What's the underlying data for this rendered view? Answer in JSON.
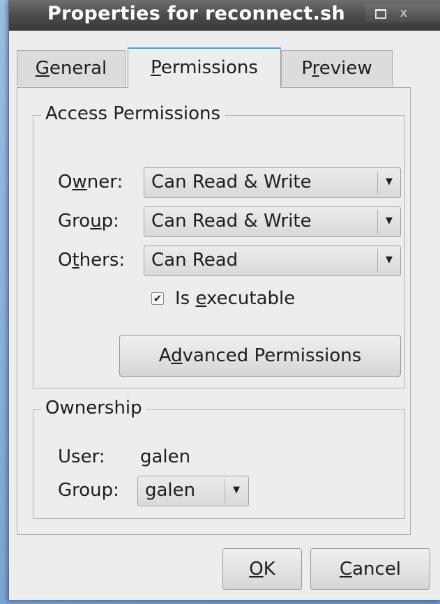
{
  "window": {
    "title": "Properties for reconnect.sh",
    "maximize_glyph": "□",
    "close_glyph": "x"
  },
  "tabs": [
    {
      "label": "General",
      "mnemonic": "G",
      "rest": "eneral"
    },
    {
      "label": "Permissions",
      "mnemonic": "P",
      "rest": "ermissions"
    },
    {
      "label": "Preview",
      "pre": "P",
      "mnemonic": "r",
      "rest": "eview"
    }
  ],
  "access": {
    "legend": "Access Permissions",
    "owner": {
      "label": "Owner:",
      "pre": "O",
      "mnemonic": "w",
      "rest": "ner:",
      "value": "Can Read & Write"
    },
    "group": {
      "label": "Group:",
      "pre": "Gro",
      "mnemonic": "u",
      "rest": "p:",
      "value": "Can Read & Write"
    },
    "others": {
      "label": "Others:",
      "pre": "O",
      "mnemonic": "t",
      "rest": "hers:",
      "value": "Can Read"
    },
    "executable": {
      "label": "Is executable",
      "pre": "Is ",
      "mnemonic": "e",
      "rest": "xecutable",
      "checked": true
    },
    "advanced_button": {
      "label": "Advanced Permissions",
      "pre": "A",
      "mnemonic": "d",
      "rest": "vanced Permissions"
    }
  },
  "ownership": {
    "legend": "Ownership",
    "user_label": "User:",
    "user_value": "galen",
    "group_label": "Group:",
    "group_value": "galen"
  },
  "buttons": {
    "ok": {
      "label": "OK",
      "mnemonic": "O",
      "rest": "K"
    },
    "cancel": {
      "label": "Cancel",
      "mnemonic": "C",
      "rest": "ancel"
    }
  },
  "icons": {
    "dropdown": "chevron-down-icon",
    "checkbox_mark": "✔"
  }
}
